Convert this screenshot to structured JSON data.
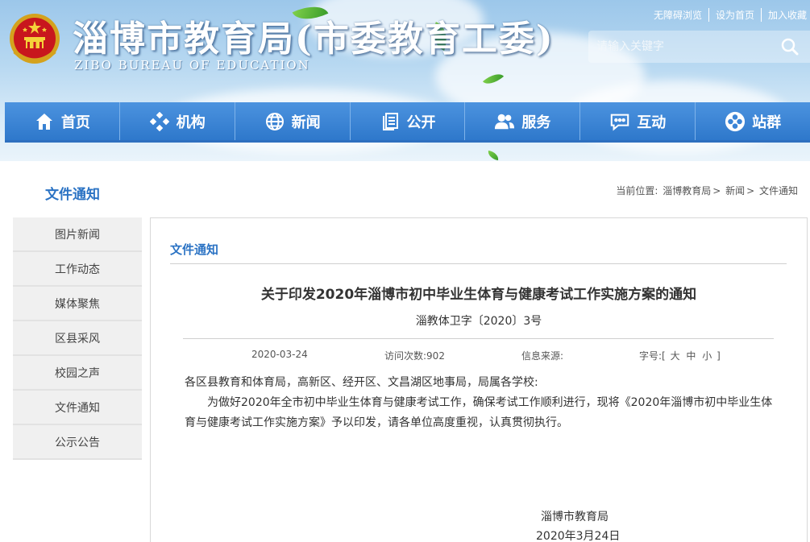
{
  "header": {
    "title": "淄博市教育局(市委教育工委)",
    "subtitle": "ZIBO BUREAU OF EDUCATION",
    "top_links": [
      "无障碍浏览",
      "设为首页",
      "加入收藏"
    ],
    "search_placeholder": "请输入关键字"
  },
  "nav": {
    "items": [
      {
        "label": "首页",
        "icon": "home-icon"
      },
      {
        "label": "机构",
        "icon": "organization-icon"
      },
      {
        "label": "新闻",
        "icon": "globe-icon"
      },
      {
        "label": "公开",
        "icon": "document-icon"
      },
      {
        "label": "服务",
        "icon": "users-icon"
      },
      {
        "label": "互动",
        "icon": "chat-icon"
      },
      {
        "label": "站群",
        "icon": "site-group-icon"
      }
    ]
  },
  "section": {
    "title": "文件通知",
    "breadcrumb": [
      "当前位置: ",
      "淄博教育局",
      "> ",
      "新闻",
      "> ",
      "文件通知"
    ]
  },
  "sidebar": {
    "items": [
      "图片新闻",
      "工作动态",
      "媒体聚焦",
      "区县采风",
      "校园之声",
      "文件通知",
      "公示公告"
    ]
  },
  "article": {
    "box_title": "文件通知",
    "title": "关于印发2020年淄博市初中毕业生体育与健康考试工作实施方案的通知",
    "doc_number": "淄教体卫字〔2020〕3号",
    "date": "2020-03-24",
    "visits": "访问次数:902",
    "source": "信息来源:",
    "fontsize_label": "字号:",
    "fontsize_open": "[",
    "fontsize_options": [
      "大",
      "中",
      "小"
    ],
    "fontsize_close": "]",
    "salutation": "各区县教育和体育局，高新区、经开区、文昌湖区地事局，局属各学校:",
    "paragraph": "为做好2020年全市初中毕业生体育与健康考试工作，确保考试工作顺利进行，现将《2020年淄博市初中毕业生体育与健康考试工作实施方案》予以印发，请各单位高度重视，认真贯彻执行。",
    "sign_org": "淄博市教育局",
    "sign_date": "2020年3月24日"
  },
  "colors": {
    "nav_blue": "#3a84d6",
    "accent_blue": "#2b73c4",
    "sidebar_bg": "#f0f0f0"
  }
}
